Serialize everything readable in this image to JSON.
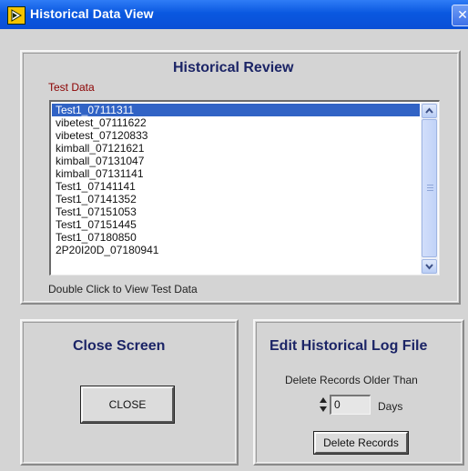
{
  "window": {
    "title": "Historical Data View",
    "close_glyph": "✕",
    "icon": "labview-run-icon"
  },
  "review": {
    "title": "Historical Review",
    "list_label": "Test Data",
    "items": [
      "Test1_07111311",
      "vibetest_07111622",
      "vibetest_07120833",
      "kimball_07121621",
      "kimball_07131047",
      "kimball_07131141",
      "Test1_07141141",
      "Test1_07141352",
      "Test1_07151053",
      "Test1_07151445",
      "Test1_07180850",
      "2P20I20D_07180941"
    ],
    "selected_index": 0,
    "hint": "Double Click to View Test Data"
  },
  "close_screen": {
    "title": "Close Screen",
    "button_label": "CLOSE"
  },
  "edit_log": {
    "title": "Edit Historical Log File",
    "delete_label": "Delete Records Older Than",
    "days_value": "0",
    "days_unit": "Days",
    "delete_button": "Delete Records"
  },
  "colors": {
    "title_bar": "#0a58e0",
    "panel_title": "#1b2466",
    "test_data_label": "#8b0000",
    "selection": "#3163c5",
    "panel_bg": "#d4d4d4"
  }
}
